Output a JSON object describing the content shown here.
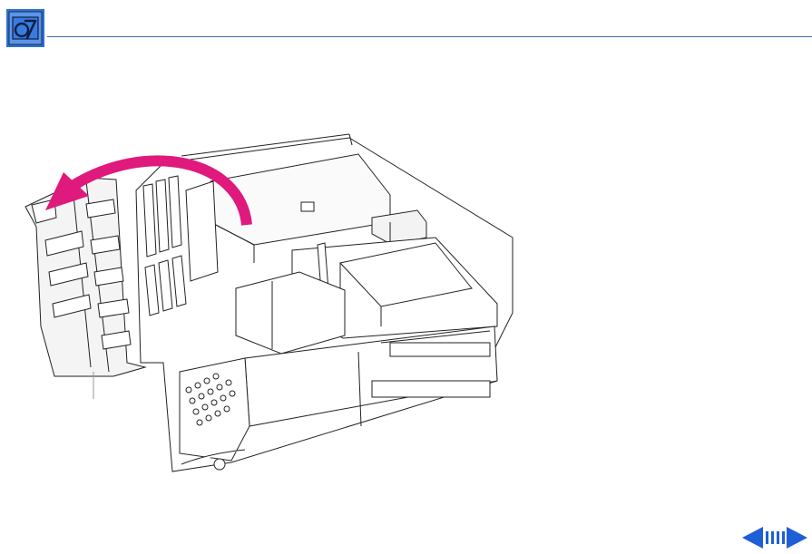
{
  "header": {
    "icon": "service-manual-logo-icon",
    "rule_color": "#3e6fb0",
    "icon_color": "#2f6fd0"
  },
  "illustration": {
    "subject": "computer-chassis-cover-removal",
    "arrow_color": "#e0197d"
  },
  "navigation": {
    "prev_icon": "left-arrow-icon",
    "toc_icon": "table-of-contents-icon",
    "next_icon": "right-arrow-icon",
    "color": "#1f5fd6"
  }
}
